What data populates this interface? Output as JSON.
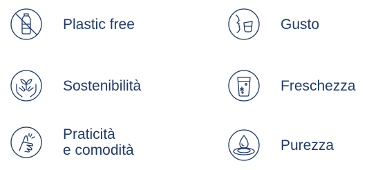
{
  "features": [
    {
      "label": "Plastic free",
      "icon": "no-plastic-bottle-icon"
    },
    {
      "label": "Gusto",
      "icon": "taste-face-glass-icon"
    },
    {
      "label": "Sostenibilità",
      "icon": "hands-with-sprout-icon"
    },
    {
      "label": "Freschezza",
      "icon": "glass-with-snowflake-icon"
    },
    {
      "label_lines": [
        "Praticità",
        "e comodità"
      ],
      "icon": "hand-snap-icon"
    },
    {
      "label": "Purezza",
      "icon": "water-drop-ripple-icon"
    }
  ],
  "colors": {
    "text": "#1e3a73",
    "icon_stroke": "#1e3a73",
    "background": "#ffffff"
  }
}
